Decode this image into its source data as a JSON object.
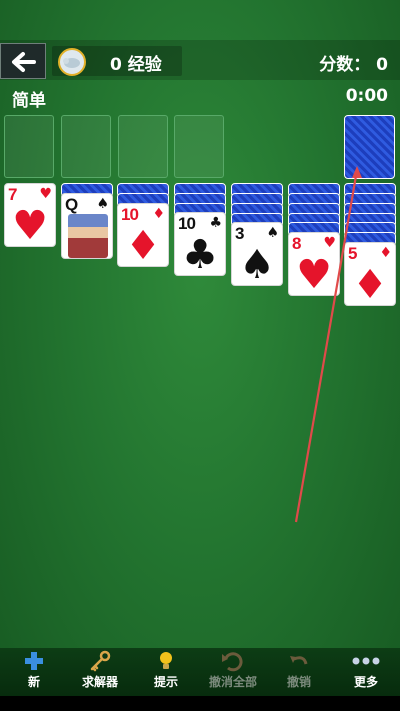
{
  "header": {
    "xp_label": "0 经验",
    "score_label": "分数：  0"
  },
  "status": {
    "difficulty": "简单",
    "timer": "0:00"
  },
  "tableau": [
    {
      "rank": "7",
      "suit": "♥",
      "color": "red"
    },
    {
      "rank": "Q",
      "suit": "♠",
      "color": "black"
    },
    {
      "rank": "10",
      "suit": "♦",
      "color": "red"
    },
    {
      "rank": "10",
      "suit": "♣",
      "color": "black"
    },
    {
      "rank": "3",
      "suit": "♠",
      "color": "black"
    },
    {
      "rank": "8",
      "suit": "♥",
      "color": "red"
    },
    {
      "rank": "5",
      "suit": "♦",
      "color": "red"
    }
  ],
  "toolbar": {
    "new_label": "新",
    "solver_label": "求解器",
    "hint_label": "提示",
    "undo_all_label": "撤消全部",
    "undo_label": "撤销",
    "more_label": "更多"
  },
  "colors": {
    "felt": "#237530",
    "card_back": "#2f5be0",
    "red_suit": "#e5142b",
    "arrow": "#e04a4a"
  }
}
